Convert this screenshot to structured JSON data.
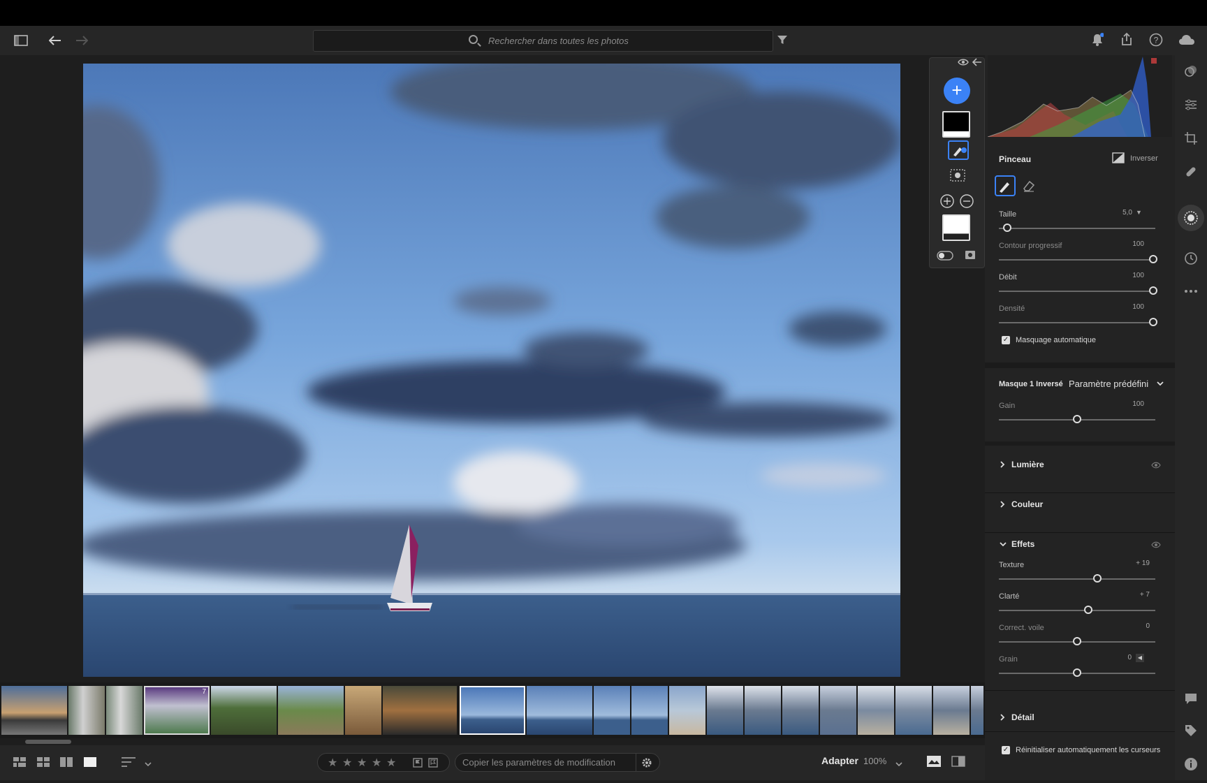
{
  "search": {
    "placeholder": "Rechercher dans toutes les photos"
  },
  "brush_panel": {
    "title": "Pinceau",
    "invert_label": "Inverser",
    "sliders": [
      {
        "label": "Taille",
        "value": "5,0",
        "level": 0.08
      },
      {
        "label": "Contour progressif",
        "value": "100",
        "level": 1.0
      },
      {
        "label": "Débit",
        "value": "100",
        "level": 1.0
      },
      {
        "label": "Densité",
        "value": "100",
        "level": 1.0
      }
    ],
    "auto_mask_label": "Masquage automatique",
    "auto_mask_checked": true
  },
  "mask_section": {
    "title": "Masque 1 Inversé",
    "preset": "Paramètre prédéfini",
    "gain_label": "Gain",
    "gain_value": "100",
    "gain_level": 0.5
  },
  "sections": {
    "light": "Lumière",
    "color": "Couleur",
    "effects": "Effets",
    "detail": "Détail"
  },
  "effects_sliders": [
    {
      "label": "Texture",
      "value": "+ 19",
      "level": 0.6
    },
    {
      "label": "Clarté",
      "value": "+ 7",
      "level": 0.54
    },
    {
      "label": "Correct. voile",
      "value": "0",
      "level": 0.5
    },
    {
      "label": "Grain",
      "value": "0",
      "level": 0.5
    }
  ],
  "reset_label": "Réinitialiser automatiquement les curseurs",
  "reset_checked": true,
  "bottombar": {
    "copy_label": "Copier les paramètres de modification",
    "fit_label": "Adapter",
    "zoom_label": "100%"
  },
  "filmstrip": {
    "thumb_badge": "7",
    "selected_index": 9
  },
  "colors": {
    "accent": "#3b82f6",
    "panel": "#232323",
    "background": "#1e1e1e"
  },
  "icons": {
    "toolbar": [
      "panel-toggle-icon",
      "back-arrow-icon",
      "forward-arrow-icon",
      "search-icon",
      "filter-icon",
      "bell-icon",
      "share-icon",
      "help-icon",
      "cloud-icon"
    ],
    "right_rail": [
      "edit-icon",
      "adjust-sliders-icon",
      "crop-icon",
      "healing-icon",
      "masking-icon",
      "history-icon",
      "more-icon",
      "comment-icon",
      "tag-icon",
      "info-icon"
    ]
  }
}
